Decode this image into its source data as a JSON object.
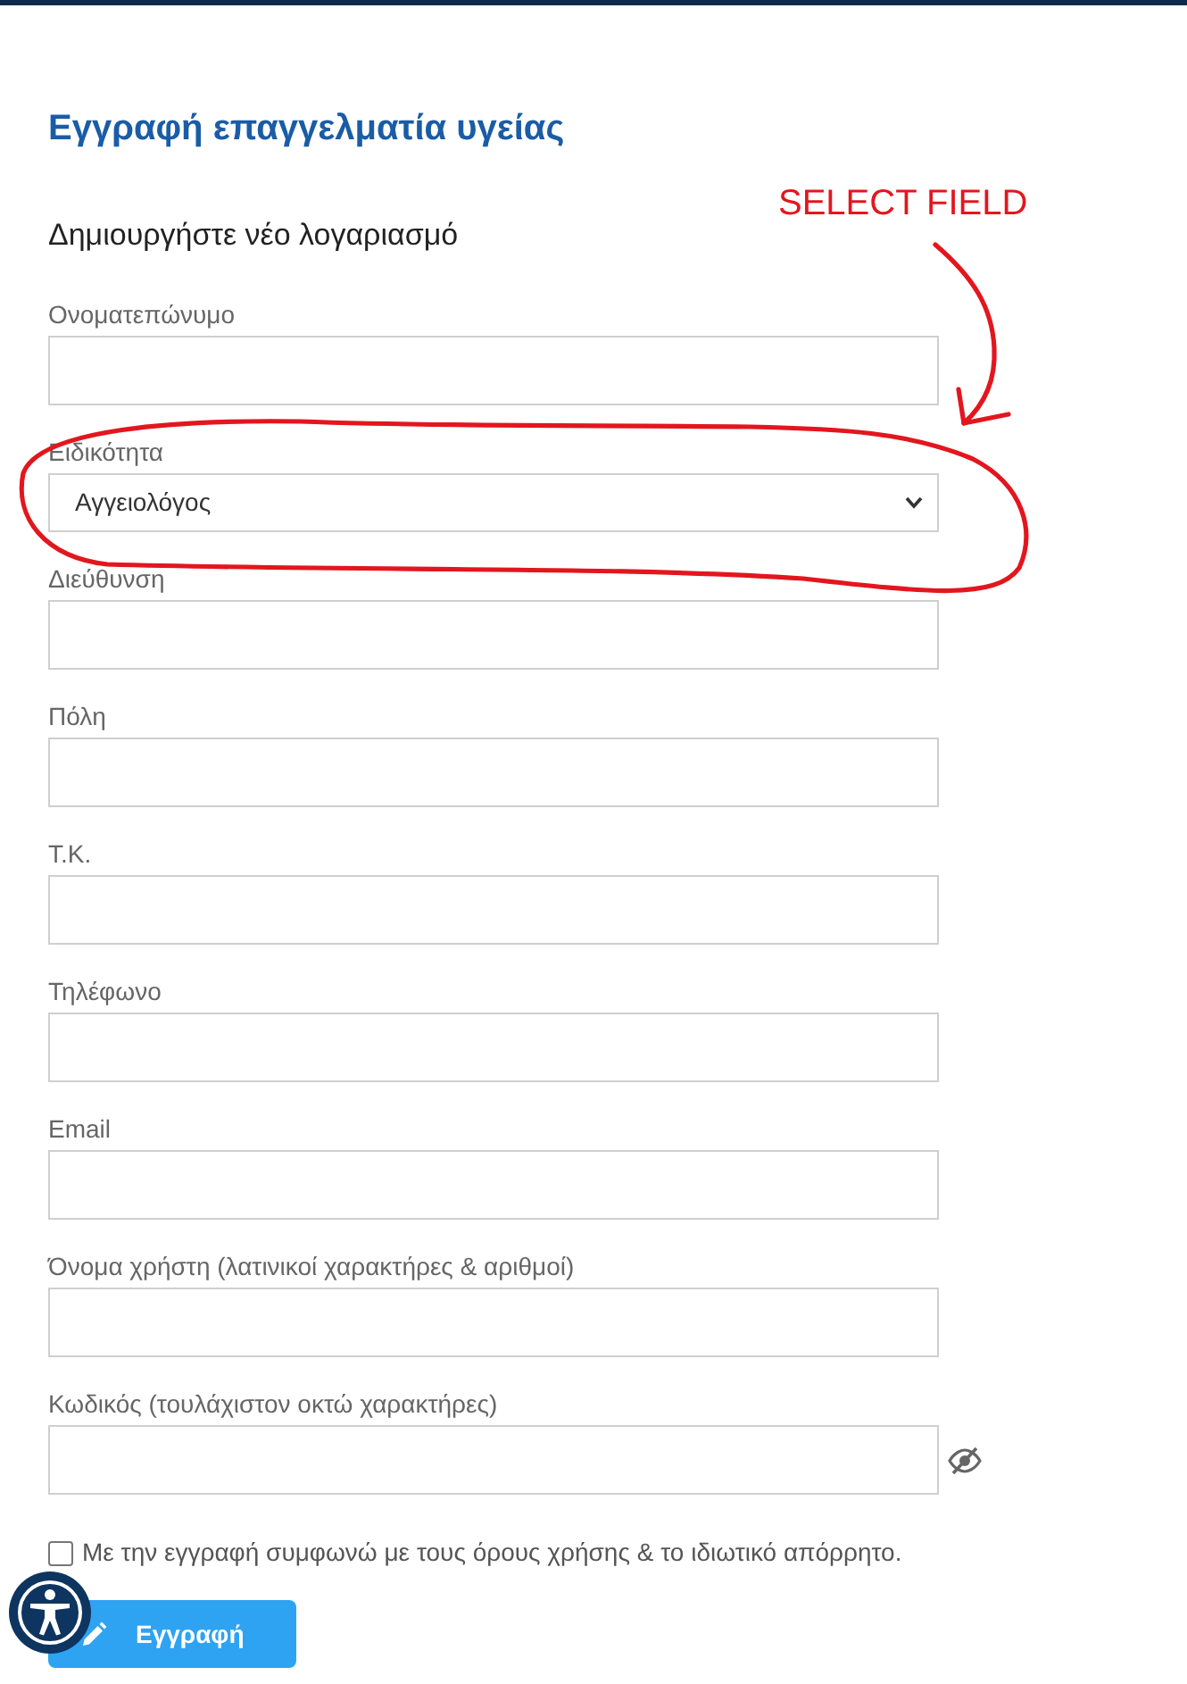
{
  "title": "Εγγραφή επαγγελματία υγείας",
  "subtitle": "Δημιουργήστε νέο λογαριασμό",
  "fields": [
    {
      "label": "Ονοματεπώνυμο",
      "kind": "text"
    },
    {
      "label": "Ειδικότητα",
      "kind": "select",
      "value": "Αγγειολόγος"
    },
    {
      "label": "Διεύθυνση",
      "kind": "text"
    },
    {
      "label": "Πόλη",
      "kind": "text"
    },
    {
      "label": "Τ.Κ.",
      "kind": "text"
    },
    {
      "label": "Τηλέφωνο",
      "kind": "text"
    },
    {
      "label": "Email",
      "kind": "text"
    },
    {
      "label": "Όνομα χρήστη (λατινικοί χαρακτήρες & αριθμοί)",
      "kind": "text"
    },
    {
      "label": "Κωδικός (τουλάχιστον οκτώ χαρακτήρες)",
      "kind": "password"
    }
  ],
  "terms": {
    "label": "Με την εγγραφή συμφωνώ με τους όρους χρήσης & το ιδιωτικό απόρρητο.",
    "checked": false
  },
  "submit_button": {
    "label": "Εγγραφή"
  },
  "annotation": {
    "text": "SELECT FIELD"
  }
}
